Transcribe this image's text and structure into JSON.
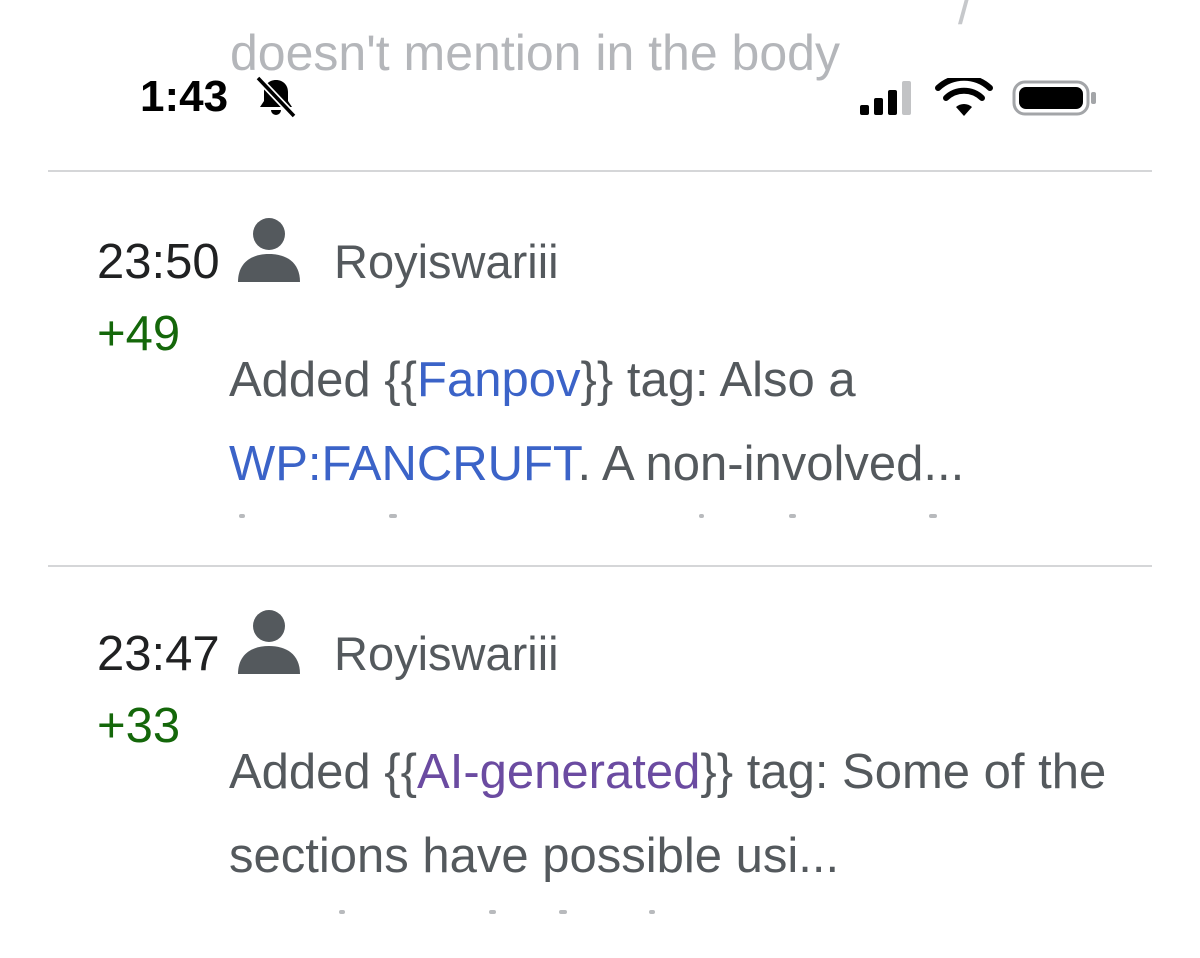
{
  "background_text": {
    "line": "doesn't mention in the body",
    "above_fragment": "/"
  },
  "status_bar": {
    "time": "1:43",
    "icons": [
      "bell-slash-icon",
      "cellular-signal-icon",
      "wifi-icon",
      "battery-icon"
    ]
  },
  "entries": [
    {
      "time": "23:50",
      "user": "Royiswariii",
      "diff": "+49",
      "summary": {
        "prefix": "Added {{",
        "tag_link": "Fanpov",
        "middle": "}} tag: Also a ",
        "policy_link": "WP:FANCRUFT",
        "suffix": ". A non-involved..."
      }
    },
    {
      "time": "23:47",
      "user": "Royiswariii",
      "diff": "+33",
      "summary": {
        "prefix": "Added {{",
        "tag_link": "AI-generated",
        "middle": "}} tag: Some of the sections have possible usi..."
      }
    }
  ],
  "colors": {
    "link": "#3b63c8",
    "visited_link": "#6b4ba1",
    "positive_diff": "#14670a",
    "secondary_text": "#54595d"
  }
}
